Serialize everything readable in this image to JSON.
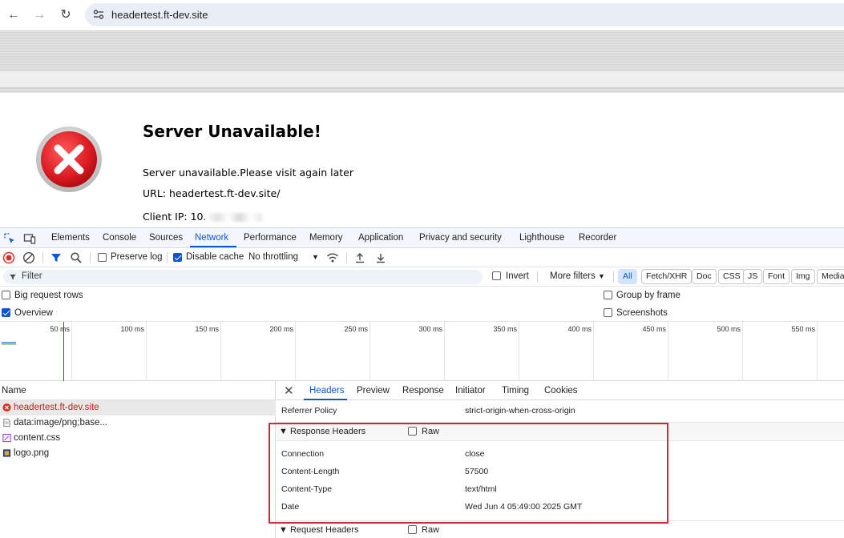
{
  "browser": {
    "url": "headertest.ft-dev.site",
    "nav": {
      "back_icon": "arrow-left-icon",
      "forward_icon": "arrow-right-icon",
      "reload_icon": "reload-icon"
    }
  },
  "error_page": {
    "title": "Server Unavailable!",
    "message": "Server unavailable.Please visit again later",
    "url_line": "URL: headertest.ft-dev.site/",
    "client_ip_label": "Client IP: 10.",
    "icon": "error-x-icon",
    "icon_color": "#d9181f"
  },
  "devtools": {
    "tabs": [
      "Elements",
      "Console",
      "Sources",
      "Network",
      "Performance",
      "Memory",
      "Application",
      "Privacy and security",
      "Lighthouse",
      "Recorder"
    ],
    "active_tab": "Network",
    "toolbar": {
      "preserve_log": "Preserve log",
      "disable_cache": "Disable cache",
      "throttling": "No throttling"
    },
    "filter": {
      "placeholder": "Filter",
      "invert": "Invert",
      "more_filters": "More filters",
      "chips": [
        "All",
        "Fetch/XHR",
        "Doc",
        "CSS",
        "JS",
        "Font",
        "Img",
        "Media"
      ]
    },
    "options": {
      "big_request_rows": "Big request rows",
      "overview": "Overview",
      "group_by_frame": "Group by frame",
      "screenshots": "Screenshots"
    },
    "overview_ticks": [
      "50 ms",
      "100 ms",
      "150 ms",
      "200 ms",
      "250 ms",
      "300 ms",
      "350 ms",
      "400 ms",
      "450 ms",
      "500 ms",
      "550 ms"
    ],
    "requests": {
      "header": "Name",
      "items": [
        {
          "name": "headertest.ft-dev.site",
          "icon": "error-icon"
        },
        {
          "name": "data:image/png;base...",
          "icon": "file-icon"
        },
        {
          "name": "content.css",
          "icon": "css-file-icon"
        },
        {
          "name": "logo.png",
          "icon": "image-file-icon"
        }
      ]
    },
    "details": {
      "tabs": [
        "Headers",
        "Preview",
        "Response",
        "Initiator",
        "Timing",
        "Cookies"
      ],
      "active_tab": "Headers",
      "referrer_policy": {
        "key": "Referrer Policy",
        "value": "strict-origin-when-cross-origin"
      },
      "response_headers": {
        "title": "▼ Response Headers",
        "raw": "Raw",
        "rows": [
          {
            "key": "Connection",
            "value": "close"
          },
          {
            "key": "Content-Length",
            "value": "57500"
          },
          {
            "key": "Content-Type",
            "value": "text/html"
          },
          {
            "key": "Date",
            "value": "Wed Jun 4 05:49:00 2025 GMT"
          }
        ]
      },
      "request_headers": {
        "title": "▼ Request Headers",
        "raw": "Raw"
      }
    },
    "colors": {
      "accent": "#0b57d0",
      "error": "#c5221f",
      "highlight": "#cc2a36"
    }
  }
}
